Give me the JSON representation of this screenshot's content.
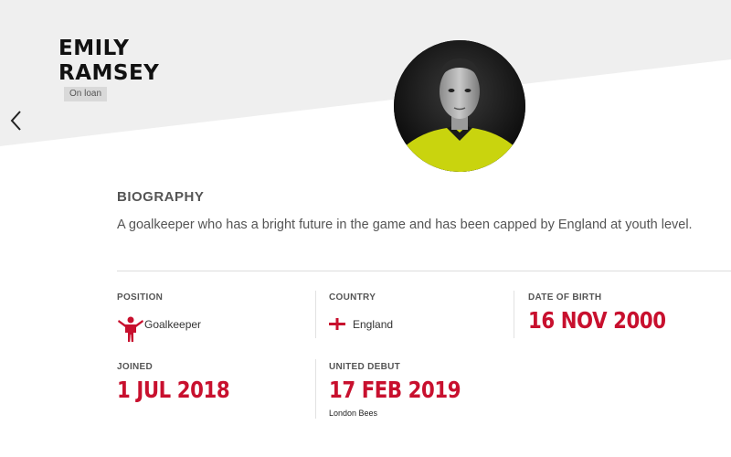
{
  "player": {
    "first_name": "EMILY",
    "last_name": "RAMSEY",
    "status": "On loan"
  },
  "biography": {
    "heading": "BIOGRAPHY",
    "text": "A goalkeeper who has a bright future in the game and has been capped by England at youth level."
  },
  "stats": {
    "position": {
      "label": "POSITION",
      "value": "Goalkeeper",
      "icon": "goalkeeper-icon"
    },
    "country": {
      "label": "COUNTRY",
      "value": "England",
      "icon": "england-flag-icon"
    },
    "dob": {
      "label": "DATE OF BIRTH",
      "value": "16 NOV 2000"
    },
    "joined": {
      "label": "JOINED",
      "value": "1 JUL 2018"
    },
    "debut": {
      "label": "UNITED DEBUT",
      "value": "17 FEB 2019",
      "opponent": "London Bees"
    }
  },
  "colors": {
    "accent": "#c8102e",
    "kit": "#d4e01a"
  }
}
